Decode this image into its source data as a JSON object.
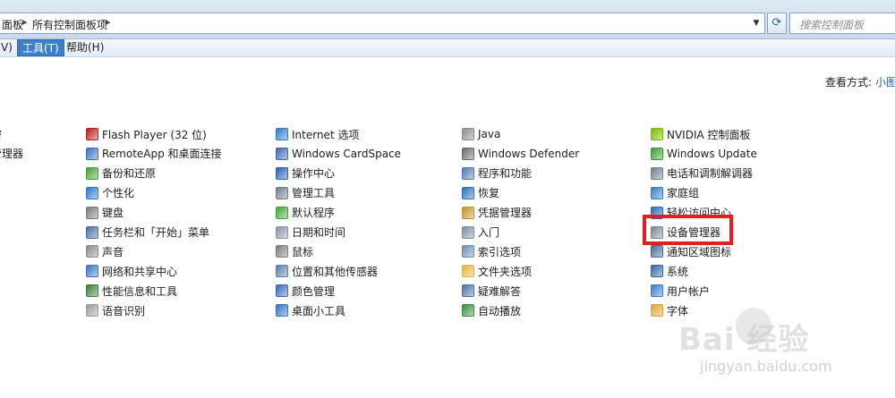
{
  "address": {
    "crumbs": [
      "面板",
      "所有控制面板项"
    ],
    "search_placeholder": "搜索控制面板"
  },
  "menu": [
    {
      "label": "V)"
    },
    {
      "label": "工具(T)",
      "active": true
    },
    {
      "label": "帮助(H)"
    }
  ],
  "viewby": {
    "label": "查看方式:",
    "value": "小图"
  },
  "columns": [
    [
      {
        "label": "密",
        "icon": "partial-icon",
        "color": "#6a7fa3"
      },
      {
        "label": "管理器",
        "icon": "partial-icon",
        "color": "#6a7fa3"
      }
    ],
    [
      {
        "label": "Flash Player (32 位)",
        "icon": "flash-icon",
        "color": "#b81d1d"
      },
      {
        "label": "RemoteApp 和桌面连接",
        "icon": "remote-desktop-icon",
        "color": "#3a72b8"
      },
      {
        "label": "备份和还原",
        "icon": "backup-icon",
        "color": "#4c9c3a"
      },
      {
        "label": "个性化",
        "icon": "personalize-icon",
        "color": "#2f78c4"
      },
      {
        "label": "键盘",
        "icon": "keyboard-icon",
        "color": "#7a7a7a"
      },
      {
        "label": "任务栏和「开始」菜单",
        "icon": "taskbar-icon",
        "color": "#4a6f9d"
      },
      {
        "label": "声音",
        "icon": "sound-icon",
        "color": "#8a8a8a"
      },
      {
        "label": "网络和共享中心",
        "icon": "network-icon",
        "color": "#3b77b8"
      },
      {
        "label": "性能信息和工具",
        "icon": "performance-icon",
        "color": "#3f7a3f"
      },
      {
        "label": "语音识别",
        "icon": "microphone-icon",
        "color": "#9a9a9a"
      }
    ],
    [
      {
        "label": "Internet 选项",
        "icon": "internet-icon",
        "color": "#2e7cc9"
      },
      {
        "label": "Windows CardSpace",
        "icon": "cardspace-icon",
        "color": "#3b68b0"
      },
      {
        "label": "操作中心",
        "icon": "flag-icon",
        "color": "#2a5fb0"
      },
      {
        "label": "管理工具",
        "icon": "admin-tools-icon",
        "color": "#6e7f92"
      },
      {
        "label": "默认程序",
        "icon": "default-programs-icon",
        "color": "#46a33a"
      },
      {
        "label": "日期和时间",
        "icon": "clock-icon",
        "color": "#8a96a6"
      },
      {
        "label": "鼠标",
        "icon": "mouse-icon",
        "color": "#7c7c7c"
      },
      {
        "label": "位置和其他传感器",
        "icon": "sensor-icon",
        "color": "#5b7fa8"
      },
      {
        "label": "颜色管理",
        "icon": "color-icon",
        "color": "#3b69b8"
      },
      {
        "label": "桌面小工具",
        "icon": "gadgets-icon",
        "color": "#3572c0"
      }
    ],
    [
      {
        "label": "Java",
        "icon": "java-icon",
        "color": "#8a8a8a"
      },
      {
        "label": "Windows Defender",
        "icon": "defender-icon",
        "color": "#6a6a6a"
      },
      {
        "label": "程序和功能",
        "icon": "programs-icon",
        "color": "#4f7cae"
      },
      {
        "label": "恢复",
        "icon": "recovery-icon",
        "color": "#2f6fb8"
      },
      {
        "label": "凭据管理器",
        "icon": "credential-icon",
        "color": "#c4942a"
      },
      {
        "label": "入门",
        "icon": "getting-started-icon",
        "color": "#7e8fa3"
      },
      {
        "label": "索引选项",
        "icon": "index-icon",
        "color": "#6b8db3"
      },
      {
        "label": "文件夹选项",
        "icon": "folder-icon",
        "color": "#e0b43c"
      },
      {
        "label": "疑难解答",
        "icon": "troubleshoot-icon",
        "color": "#4d73a6"
      },
      {
        "label": "自动播放",
        "icon": "autoplay-icon",
        "color": "#3c8d3c"
      }
    ],
    [
      {
        "label": "NVIDIA 控制面板",
        "icon": "nvidia-icon",
        "color": "#76b900"
      },
      {
        "label": "Windows Update",
        "icon": "windows-update-icon",
        "color": "#3d9b35"
      },
      {
        "label": "电话和调制解调器",
        "icon": "phone-icon",
        "color": "#6e7d90"
      },
      {
        "label": "家庭组",
        "icon": "homegroup-icon",
        "color": "#3a7dc2"
      },
      {
        "label": "轻松访问中心",
        "icon": "ease-access-icon",
        "color": "#2d69b3"
      },
      {
        "label": "设备管理器",
        "icon": "device-manager-icon",
        "color": "#7b8896"
      },
      {
        "label": "通知区域图标",
        "icon": "notification-icon",
        "color": "#4a6a92"
      },
      {
        "label": "系统",
        "icon": "system-icon",
        "color": "#35679f"
      },
      {
        "label": "用户帐户",
        "icon": "user-icon",
        "color": "#3b7bc7"
      },
      {
        "label": "字体",
        "icon": "font-icon",
        "color": "#d9a737"
      }
    ]
  ],
  "watermark": {
    "main": "Bai 经验",
    "sub": "jingyan.baidu.com"
  }
}
